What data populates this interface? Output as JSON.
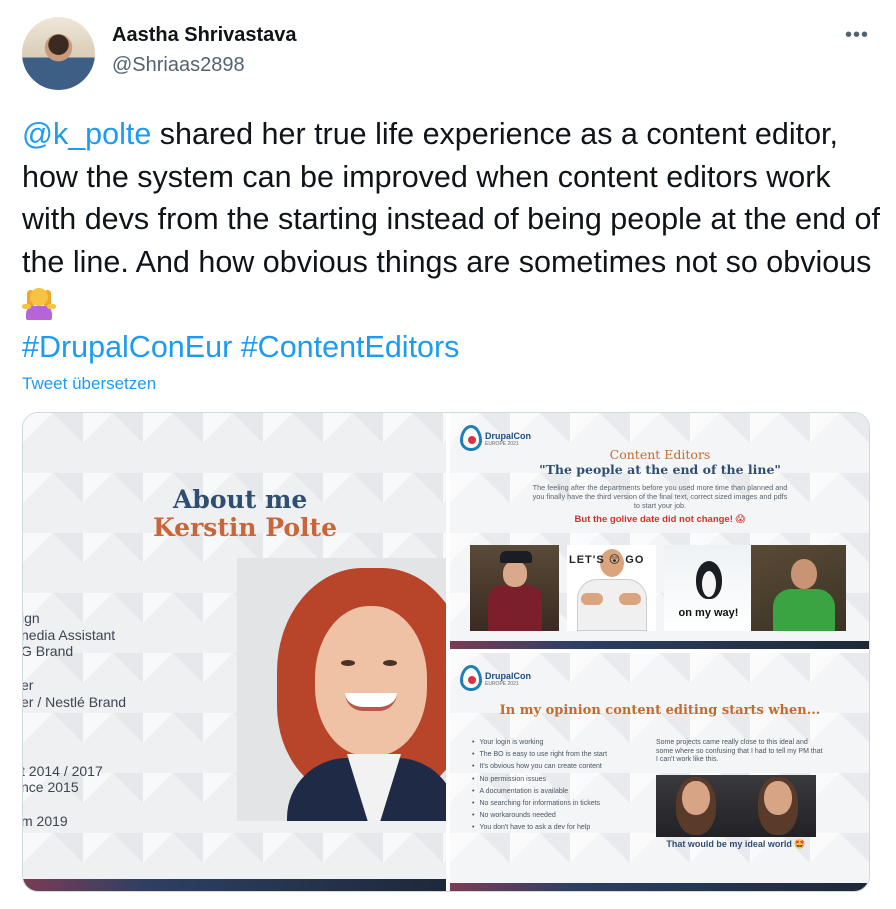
{
  "author": {
    "name": "Aastha Shrivastava",
    "handle": "@Shriaas2898"
  },
  "more_label": "•••",
  "tweet": {
    "mention": "@k_polte",
    "text": " shared her true life experience as a content editor, how the system can be improved when content editors work with devs from the starting instead of being people at the end of the line. And how obvious things are sometimes not so obvious",
    "emoji": "person-shrugging-icon",
    "hashtag1": "#DrupalConEur",
    "hashtag2": "#ContentEditors",
    "translate_label": "Tweet übersetzen"
  },
  "colors": {
    "link": "#1d9bf0",
    "text": "#0f1419",
    "secondary": "#536471"
  },
  "media": {
    "about": {
      "title": "About me",
      "name": "Kerstin Polte",
      "cv_lines": [
        "ign",
        "nedia Assistant",
        "G Brand",
        "er",
        "er / Nestlé Brand",
        "t 2014 / 2017",
        "nce 2015",
        "m 2019"
      ]
    },
    "slide2": {
      "logo_text": "DrupalCon",
      "logo_sub": "EUROPE 2021",
      "title": "Content Editors",
      "subtitle": "\"The people at the end of the line\"",
      "description": "The feeling after the departments before you used more time than planned and you finally have the third version of the final text, correct sized images and pdfs to start your job.",
      "alert": "But the golive date did not change! 😱",
      "gif_letsgo": "LET'S 😲 GO",
      "gif_caption": "on my way!"
    },
    "slide3": {
      "logo_text": "DrupalCon",
      "logo_sub": "EUROPE 2021",
      "title": "In my opinion content editing starts when...",
      "bullets": [
        "Your login is working",
        "The BO is easy to use right from the start",
        "It's obvious how you can create content",
        "No permission issues",
        "A documentation is available",
        "No searching for informations in tickets",
        "No workarounds needed",
        "You don't have to ask a dev for help"
      ],
      "right_text": "Some projects came really close to this ideal and some where so confusing that I had to tell my PM that I can't work like this.",
      "caption": "That would be my ideal world 🤩"
    }
  }
}
